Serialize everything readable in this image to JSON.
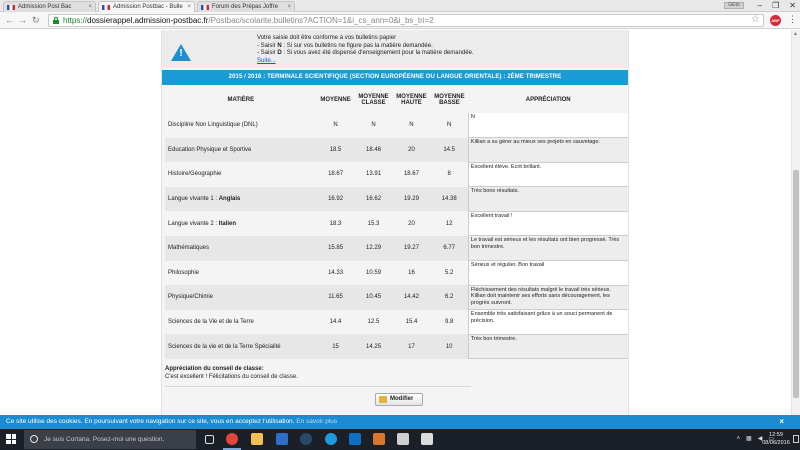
{
  "browser": {
    "tabs": [
      {
        "label": "Admission Post Bac",
        "active": false
      },
      {
        "label": "Admission Postbac - Bulle",
        "active": true
      },
      {
        "label": "Forum des Prépas Joffre",
        "active": false
      }
    ],
    "user_badge": "GEto",
    "url_scheme": "https://",
    "url_host": "dossierappel.admission-postbac.fr",
    "url_path": "/Postbac/scolarite.bulletins?ACTION=1&i_cs_ann=0&i_bs_tri=2",
    "extension_label": "ABP"
  },
  "notice": {
    "line1": "Votre saisie doit être conforme à vos bulletins papier",
    "line2_prefix": "- Saisir ",
    "line2_key": "N",
    "line2_rest": " : Si sur vos bulletins ne figure pas la matière demandée.",
    "line3_prefix": "- Saisir ",
    "line3_key": "D",
    "line3_rest": " : Si vous avez été dispensé d'enseignement pour la matière demandée.",
    "more_link": "Suite..."
  },
  "banner": "2015 / 2016 : TERMINALE SCIENTIFIQUE (SECTION EUROPÉENNE OU LANGUE ORIENTALE) : 2ÈME TRIMESTRE",
  "table": {
    "headers": {
      "matiere": "MATIÈRE",
      "moyenne": "MOYENNE",
      "moyenne_classe": "MOYENNE CLASSE",
      "moyenne_haute": "MOYENNE HAUTE",
      "moyenne_basse": "MOYENNE BASSE",
      "appreciation": "APPRÉCIATION"
    },
    "rows": [
      {
        "subject": "Discipline Non Linguistique (DNL)",
        "subject_bold": "",
        "moy": "N",
        "classe": "N",
        "haute": "N",
        "basse": "N",
        "appreciation": "N"
      },
      {
        "subject": "Education Physique et Sportive",
        "subject_bold": "",
        "moy": "18.5",
        "classe": "18.46",
        "haute": "20",
        "basse": "14.5",
        "appreciation": "Killian a su gérer au mieux ses projets en sauvetage."
      },
      {
        "subject": "Histoire/Géographie",
        "subject_bold": "",
        "moy": "18.67",
        "classe": "13.91",
        "haute": "18.67",
        "basse": "8",
        "appreciation": "Excellent élève. Ecrit brillant."
      },
      {
        "subject": "Langue vivante 1 : ",
        "subject_bold": "Anglais",
        "moy": "16.92",
        "classe": "16.62",
        "haute": "19.29",
        "basse": "14.38",
        "appreciation": "Très bons résultats."
      },
      {
        "subject": "Langue vivante 2 : ",
        "subject_bold": "Italien",
        "moy": "18.3",
        "classe": "15.3",
        "haute": "20",
        "basse": "12",
        "appreciation": "Excellent travail !"
      },
      {
        "subject": "Mathématiques",
        "subject_bold": "",
        "moy": "15.85",
        "classe": "12.29",
        "haute": "19.27",
        "basse": "6.77",
        "appreciation": "Le travail est sérieux et les résultats ont bien progressé. Très bon trimestre."
      },
      {
        "subject": "Philosophie",
        "subject_bold": "",
        "moy": "14.33",
        "classe": "10.59",
        "haute": "16",
        "basse": "5.2",
        "appreciation": "Sérieux et régulier. Bon travail"
      },
      {
        "subject": "Physique/Chimie",
        "subject_bold": "",
        "moy": "11.65",
        "classe": "10.45",
        "haute": "14.42",
        "basse": "6.2",
        "appreciation": "Fléchissement des résultats malgré le travail très sérieux. Killian doit maintenir ses efforts sans découragement, les progrès suivront."
      },
      {
        "subject": "Sciences de la Vie et de la Terre",
        "subject_bold": "",
        "moy": "14.4",
        "classe": "12.5",
        "haute": "15.4",
        "basse": "9.8",
        "appreciation": "Ensemble très satisfaisant grâce à un souci permanent de précision."
      },
      {
        "subject": "Sciences de la vie et de la Terre Spécialité",
        "subject_bold": "",
        "moy": "15",
        "classe": "14.25",
        "haute": "17",
        "basse": "10",
        "appreciation": "Très bon trimestre."
      }
    ]
  },
  "conseil": {
    "label": "Appréciation du conseil de classe:",
    "text": "C'est excellent ! Félicitations du conseil de classe."
  },
  "modify_button": "Modifier",
  "cookie": {
    "text": "Ce site utilise des cookies. En poursuivant votre navigation sur ce site, vous en acceptez l'utilisation. ",
    "link": "En savoir plus",
    "close": "×"
  },
  "taskbar": {
    "search_placeholder": "Je suis Cortana. Posez-moi une question.",
    "time": "12:59",
    "date": "08/06/2016",
    "icons": [
      "task-view-icon",
      "chrome-icon",
      "file-explorer-icon",
      "store-icon",
      "steam-icon",
      "skype-icon",
      "teamviewer-icon",
      "sigil-icon",
      "app-icon",
      "photos-icon"
    ],
    "colors": {
      "chrome": "#e4443b",
      "explorer": "#f2c14e",
      "store": "#2d6fc8",
      "steam": "#274a6b",
      "skype": "#1e9ae0",
      "teamviewer": "#0e6fc3",
      "sigil": "#d9772d",
      "app": "#cfcfcf",
      "photos": "#dcdcdc"
    }
  }
}
